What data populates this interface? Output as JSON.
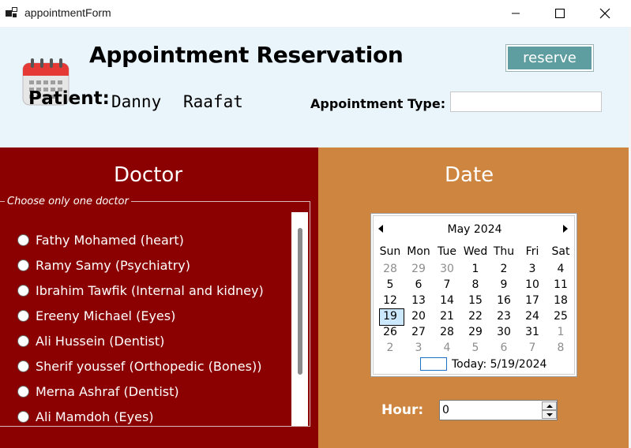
{
  "window": {
    "title": "appointmentForm"
  },
  "header": {
    "title": "Appointment Reservation",
    "reserve_label": "reserve",
    "patient_label": "Patient:",
    "patient_first": "Danny",
    "patient_last": "Raafat",
    "appointment_type_label": "Appointment Type:",
    "appointment_type_value": ""
  },
  "doctor_panel": {
    "heading": "Doctor",
    "group_label": "Choose only one doctor",
    "doctors": [
      "Fathy Mohamed (heart)",
      "Ramy Samy (Psychiatry)",
      "Ibrahim Tawfik (Internal and kidney)",
      "Ereeny Michael (Eyes)",
      "Ali Hussein (Dentist)",
      "Sherif youssef (Orthopedic (Bones))",
      "Merna Ashraf (Dentist)",
      "Ali Mamdoh (Eyes)"
    ]
  },
  "date_panel": {
    "heading": "Date",
    "calendar": {
      "month_label": "May 2024",
      "day_headers": [
        "Sun",
        "Mon",
        "Tue",
        "Wed",
        "Thu",
        "Fri",
        "Sat"
      ],
      "weeks": [
        [
          "28",
          "29",
          "30",
          "1",
          "2",
          "3",
          "4"
        ],
        [
          "5",
          "6",
          "7",
          "8",
          "9",
          "10",
          "11"
        ],
        [
          "12",
          "13",
          "14",
          "15",
          "16",
          "17",
          "18"
        ],
        [
          "19",
          "20",
          "21",
          "22",
          "23",
          "24",
          "25"
        ],
        [
          "26",
          "27",
          "28",
          "29",
          "30",
          "31",
          "1"
        ],
        [
          "2",
          "3",
          "4",
          "5",
          "6",
          "7",
          "8"
        ]
      ],
      "selected_day": "19",
      "today_label": "Today: 5/19/2024"
    },
    "hour_label": "Hour:",
    "hour_value": "0"
  },
  "colors": {
    "doctor_panel_bg": "#8b0000",
    "date_panel_bg": "#cd853f",
    "header_bg": "#eaf4fb",
    "reserve_button_bg": "#5f9ea0"
  }
}
